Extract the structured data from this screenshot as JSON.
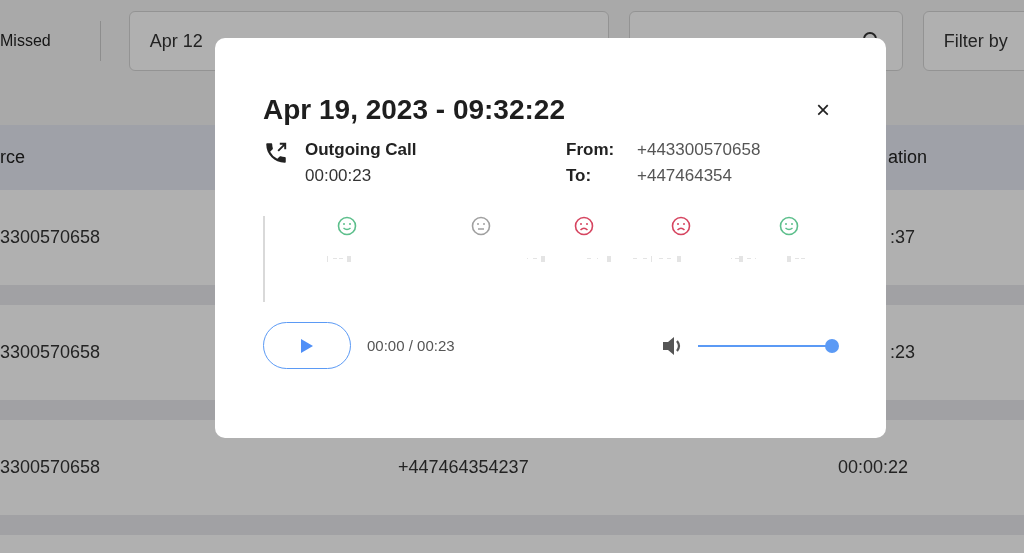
{
  "filters": {
    "status_label": "Missed",
    "date_range": "Apr 12",
    "filter_select": "Filter by"
  },
  "table": {
    "columns": [
      "rce",
      "ation"
    ],
    "rows": [
      {
        "col_1": "3300570658",
        "col_3": ":37"
      },
      {
        "col_1": "3300570658",
        "col_3": ":23"
      },
      {
        "col_1": "3300570658",
        "col_2": "+447464354237",
        "col_3": "00:00:22"
      },
      {}
    ]
  },
  "dialog": {
    "title": "Apr 19, 2023 - 09:32:22",
    "close": "×",
    "call_type": "Outgoing Call",
    "call_duration": "00:00:23",
    "details": [
      {
        "label": "From:",
        "value": "+443300570658"
      },
      {
        "label": "To:",
        "value": "+447464354"
      }
    ],
    "sentiments": [
      {
        "kind": "positive"
      },
      {
        "kind": "neutral"
      },
      {
        "kind": "negative"
      },
      {
        "kind": "negative"
      },
      {
        "kind": "positive"
      }
    ],
    "player": {
      "time": "00:00 / 00:23",
      "volume": {
        "level": 1
      }
    }
  }
}
